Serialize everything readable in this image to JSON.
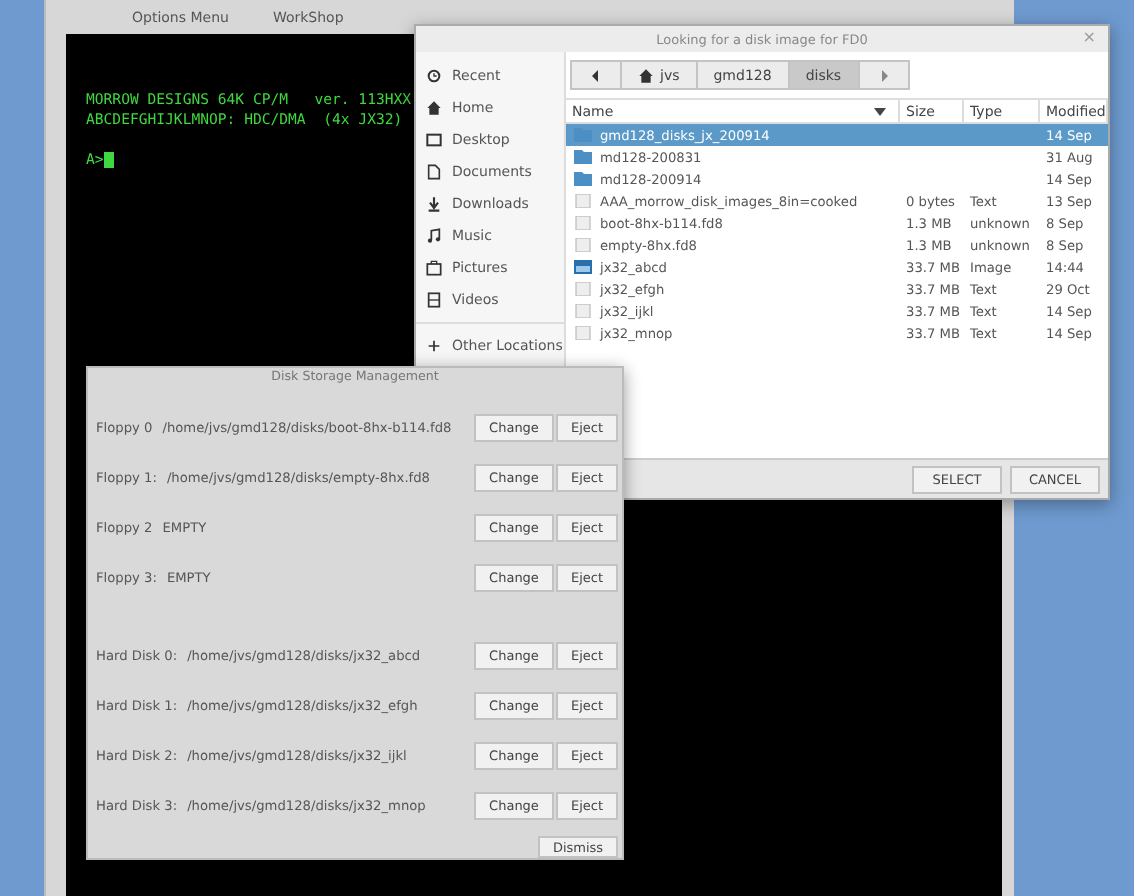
{
  "emulator": {
    "menu": [
      "Options Menu",
      "WorkShop"
    ],
    "terminal": {
      "lines": [
        "MORROW DESIGNS 64K CP/M   ver. 113HXX",
        "ABCDEFGHIJKLMNOP: HDC/DMA  (4x JX32)"
      ],
      "prompt": "A>"
    }
  },
  "file_dialog": {
    "title": "Looking for a disk image for FD0",
    "close": "×",
    "sidebar": [
      {
        "label": "Recent"
      },
      {
        "label": "Home"
      },
      {
        "label": "Desktop"
      },
      {
        "label": "Documents"
      },
      {
        "label": "Downloads"
      },
      {
        "label": "Music"
      },
      {
        "label": "Pictures"
      },
      {
        "label": "Videos"
      },
      {
        "label": "Other Locations"
      }
    ],
    "path": [
      {
        "label": "jvs",
        "selected": false
      },
      {
        "label": "gmd128",
        "selected": false
      },
      {
        "label": "disks",
        "selected": true
      }
    ],
    "columns": [
      "Name",
      "Size",
      "Type",
      "Modified"
    ],
    "rows": [
      {
        "name": "gmd128_disks_jx_200914",
        "size": "",
        "type": "",
        "modified": "14 Sep",
        "kind": "folder",
        "selected": true
      },
      {
        "name": "md128-200831",
        "size": "",
        "type": "",
        "modified": "31 Aug",
        "kind": "folder",
        "selected": false
      },
      {
        "name": "md128-200914",
        "size": "",
        "type": "",
        "modified": "14 Sep",
        "kind": "folder",
        "selected": false
      },
      {
        "name": "AAA_morrow_disk_images_8in=cooked",
        "size": "0 bytes",
        "type": "Text",
        "modified": "13 Sep",
        "kind": "file",
        "selected": false
      },
      {
        "name": "boot-8hx-b114.fd8",
        "size": "1.3 MB",
        "type": "unknown",
        "modified": "8 Sep",
        "kind": "file",
        "selected": false
      },
      {
        "name": "empty-8hx.fd8",
        "size": "1.3 MB",
        "type": "unknown",
        "modified": "8 Sep",
        "kind": "file",
        "selected": false
      },
      {
        "name": "jx32_abcd",
        "size": "33.7 MB",
        "type": "Image",
        "modified": "14:44",
        "kind": "image",
        "selected": false
      },
      {
        "name": "jx32_efgh",
        "size": "33.7 MB",
        "type": "Text",
        "modified": "29 Oct",
        "kind": "file",
        "selected": false
      },
      {
        "name": "jx32_ijkl",
        "size": "33.7 MB",
        "type": "Text",
        "modified": "14 Sep",
        "kind": "file",
        "selected": false
      },
      {
        "name": "jx32_mnop",
        "size": "33.7 MB",
        "type": "Text",
        "modified": "14 Sep",
        "kind": "file",
        "selected": false
      }
    ],
    "buttons": [
      "SELECT",
      "CANCEL"
    ]
  },
  "disk_dialog": {
    "title": "Disk Storage Management",
    "floppies": [
      {
        "label": "Floppy 0",
        "value": "/home/jvs/gmd128/disks/boot-8hx-b114.fd8",
        "buttons": [
          "Change",
          "Eject"
        ]
      },
      {
        "label": "Floppy 1:",
        "value": "/home/jvs/gmd128/disks/empty-8hx.fd8",
        "buttons": [
          "Change",
          "Eject"
        ]
      },
      {
        "label": "Floppy 2",
        "value": "EMPTY",
        "buttons": [
          "Change",
          "Eject"
        ]
      },
      {
        "label": "Floppy 3:",
        "value": "EMPTY",
        "buttons": [
          "Change",
          "Eject"
        ]
      }
    ],
    "hard_disks": [
      {
        "label": "Hard Disk 0:",
        "value": "/home/jvs/gmd128/disks/jx32_abcd",
        "buttons": [
          "Change",
          "Eject"
        ]
      },
      {
        "label": "Hard Disk 1:",
        "value": "/home/jvs/gmd128/disks/jx32_efgh",
        "buttons": [
          "Change",
          "Eject"
        ]
      },
      {
        "label": "Hard Disk 2:",
        "value": "/home/jvs/gmd128/disks/jx32_ijkl",
        "buttons": [
          "Change",
          "Eject"
        ]
      },
      {
        "label": "Hard Disk 3:",
        "value": "/home/jvs/gmd128/disks/jx32_mnop",
        "buttons": [
          "Change",
          "Eject"
        ]
      }
    ],
    "dismiss": "Dismiss"
  }
}
